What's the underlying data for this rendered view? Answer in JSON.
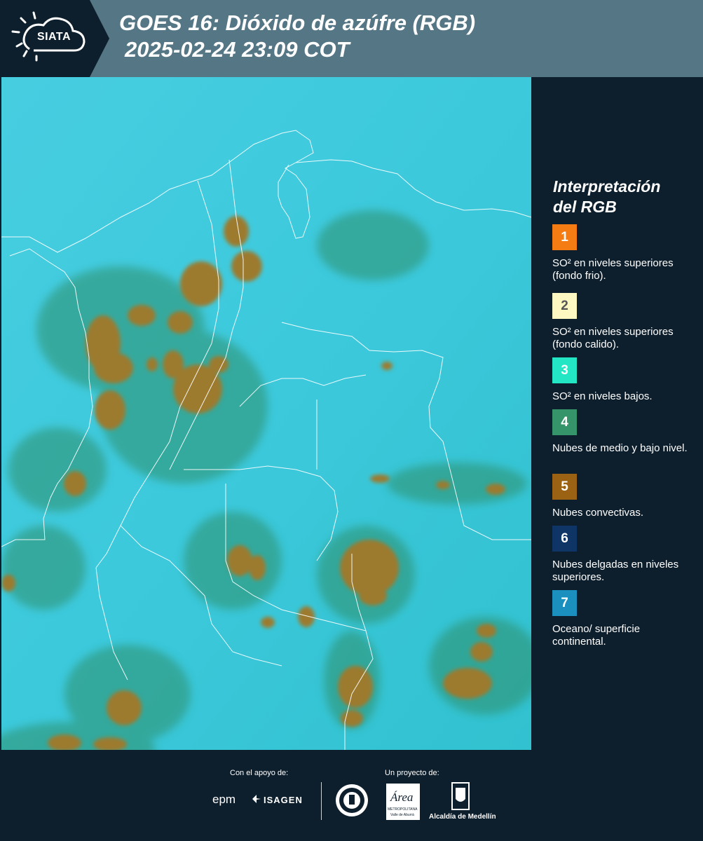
{
  "header": {
    "logo_text": "SIATA",
    "title_line1": "GOES 16: Dióxido de azúfre (RGB)",
    "title_line2": "2025-02-24 23:09 COT"
  },
  "legend": {
    "title_line1": "Interpretación",
    "title_line2": "del RGB",
    "items": [
      {
        "num": "1",
        "color": "#f57c12",
        "text": "SO² en niveles superiores (fondo frio)."
      },
      {
        "num": "2",
        "color": "#fdf7c2",
        "text": "SO² en niveles superiores (fondo calido)."
      },
      {
        "num": "3",
        "color": "#22e6c4",
        "text": "SO² en niveles bajos."
      },
      {
        "num": "4",
        "color": "#36946a",
        "text": "Nubes de medio y bajo nivel."
      },
      {
        "num": "5",
        "color": "#9a6212",
        "text": "Nubes convectivas."
      },
      {
        "num": "6",
        "color": "#0e3566",
        "text": "Nubes delgadas en niveles superiores."
      },
      {
        "num": "7",
        "color": "#1b8fbd",
        "text": "Oceano/ superficie continental."
      }
    ]
  },
  "footer": {
    "support_label": "Con el apoyo de:",
    "project_label": "Un proyecto de:",
    "sponsor_epm": "epm",
    "sponsor_isagen": "ISAGEN",
    "area_metro_logo": "Área",
    "area_metro_sub1": "METROPOLITANA",
    "area_metro_sub2": "Valle de Aburrá",
    "alcaldia": "Alcaldía de Medellín"
  },
  "map": {
    "background_color": "#3cc9dc",
    "cloud_color": "#9c7a2e",
    "low_cloud_color": "#2f8f6a",
    "border_color": "#ffffff"
  }
}
